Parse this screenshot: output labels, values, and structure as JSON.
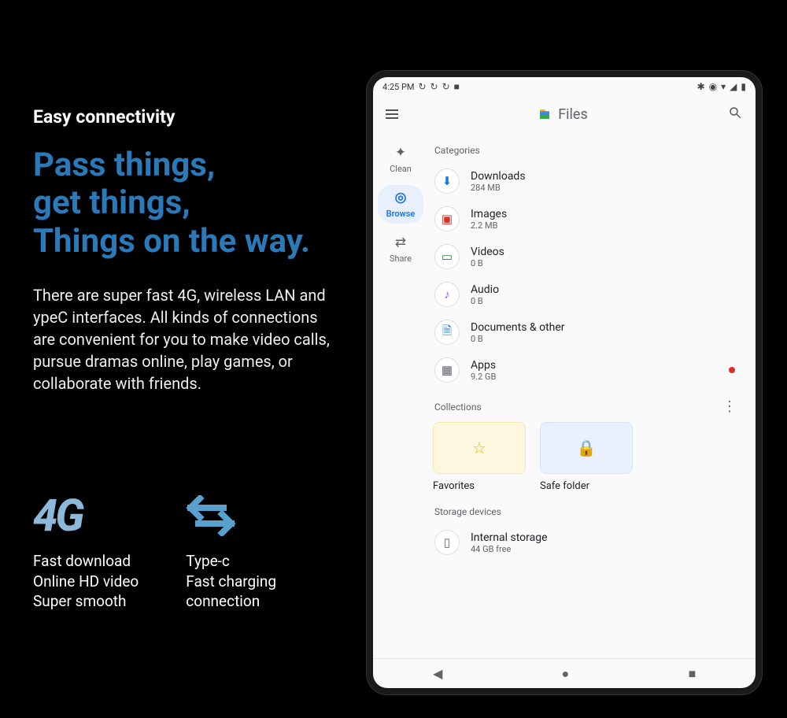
{
  "promo": {
    "subtitle": "Easy connectivity",
    "headline_l1": "Pass things,",
    "headline_l2": "get things,",
    "headline_l3": "Things on the way.",
    "body": "There are super fast 4G, wireless LAN and ypeC interfaces. All kinds of connections are convenient for you to make video calls, pursue dramas online, play games, or collaborate with friends."
  },
  "features": {
    "f1": {
      "icon_text": "4G",
      "l1": "Fast download",
      "l2": "Online HD video",
      "l3": "Super smooth"
    },
    "f2": {
      "l1": "Type-c",
      "l2": "Fast charging",
      "l3": "connection"
    }
  },
  "status": {
    "time": "4:25 PM"
  },
  "app": {
    "title": "Files",
    "rail": {
      "clean": "Clean",
      "browse": "Browse",
      "share": "Share"
    },
    "sections": {
      "categories": "Categories",
      "collections": "Collections",
      "storage": "Storage devices"
    },
    "cats": {
      "downloads": {
        "name": "Downloads",
        "sub": "284 MB"
      },
      "images": {
        "name": "Images",
        "sub": "2.2 MB"
      },
      "videos": {
        "name": "Videos",
        "sub": "0 B"
      },
      "audio": {
        "name": "Audio",
        "sub": "0 B"
      },
      "docs": {
        "name": "Documents & other",
        "sub": "0 B"
      },
      "apps": {
        "name": "Apps",
        "sub": "9.2 GB"
      }
    },
    "collections_cards": {
      "favorites": "Favorites",
      "safe": "Safe folder"
    },
    "storage_item": {
      "name": "Internal storage",
      "sub": "44 GB free"
    }
  }
}
